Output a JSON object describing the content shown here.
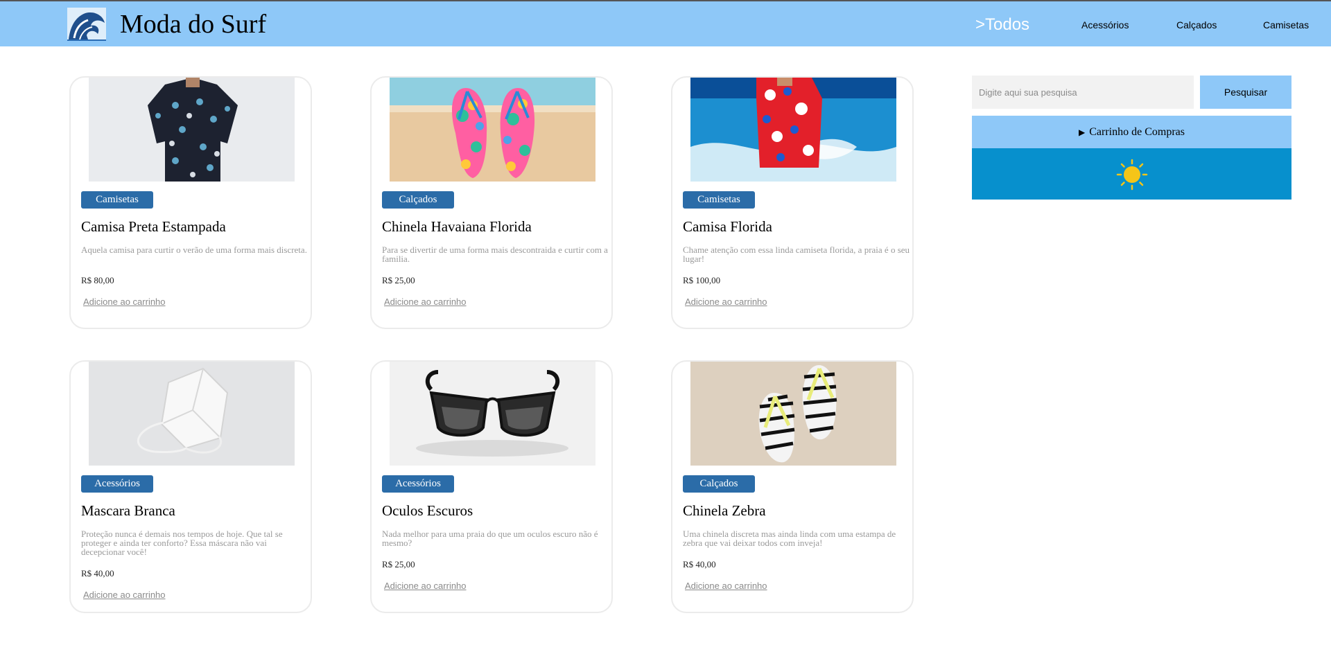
{
  "header": {
    "brand": "Moda do Surf",
    "nav": [
      {
        "label": ">Todos",
        "active": true
      },
      {
        "label": "Acessórios",
        "active": false
      },
      {
        "label": "Calçados",
        "active": false
      },
      {
        "label": "Camisetas",
        "active": false
      }
    ]
  },
  "products": [
    {
      "category": "Camisetas",
      "name": "Camisa Preta Estampada",
      "description": "Aquela camisa para curtir o verão de uma forma mais discreta.",
      "price": "R$ 80,00",
      "add_label": "Adicione ao carrinho",
      "image_icon": "black-printed-shirt"
    },
    {
      "category": "Calçados",
      "name": "Chinela Havaiana Florida",
      "description": "Para se divertir de uma forma mais descontraida e curtir com a familia.",
      "price": "R$ 25,00",
      "add_label": "Adicione ao carrinho",
      "image_icon": "floral-flip-flops"
    },
    {
      "category": "Camisetas",
      "name": "Camisa Florida",
      "description": "Chame atenção com essa linda camiseta florida, a praia é o seu lugar!",
      "price": "R$ 100,00",
      "add_label": "Adicione ao carrinho",
      "image_icon": "floral-shirt"
    },
    {
      "category": "Acessórios",
      "name": "Mascara Branca",
      "description": "Proteção nunca é demais nos tempos de hoje. Que tal se proteger e ainda ter conforto? Essa máscara não vai decepcionar você!",
      "price": "R$ 40,00",
      "add_label": "Adicione ao carrinho",
      "image_icon": "white-mask"
    },
    {
      "category": "Acessórios",
      "name": "Oculos Escuros",
      "description": "Nada melhor para uma praia do que um oculos escuro não é mesmo?",
      "price": "R$ 25,00",
      "add_label": "Adicione ao carrinho",
      "image_icon": "sunglasses"
    },
    {
      "category": "Calçados",
      "name": "Chinela Zebra",
      "description": "Uma chinela discreta mas ainda linda com uma estampa de zebra que vai deixar todos com inveja!",
      "price": "R$ 40,00",
      "add_label": "Adicione ao carrinho",
      "image_icon": "zebra-flip-flops"
    }
  ],
  "sidebar": {
    "search_placeholder": "Digite aqui sua pesquisa",
    "search_button": "Pesquisar",
    "cart_label": "Carrinho de Compras",
    "weather_icon": "sun-icon"
  },
  "colors": {
    "header_bg": "#8ec8f8",
    "badge_bg": "#2b6ca8",
    "weather_bg": "#0790cd",
    "sun": "#f5c518"
  }
}
